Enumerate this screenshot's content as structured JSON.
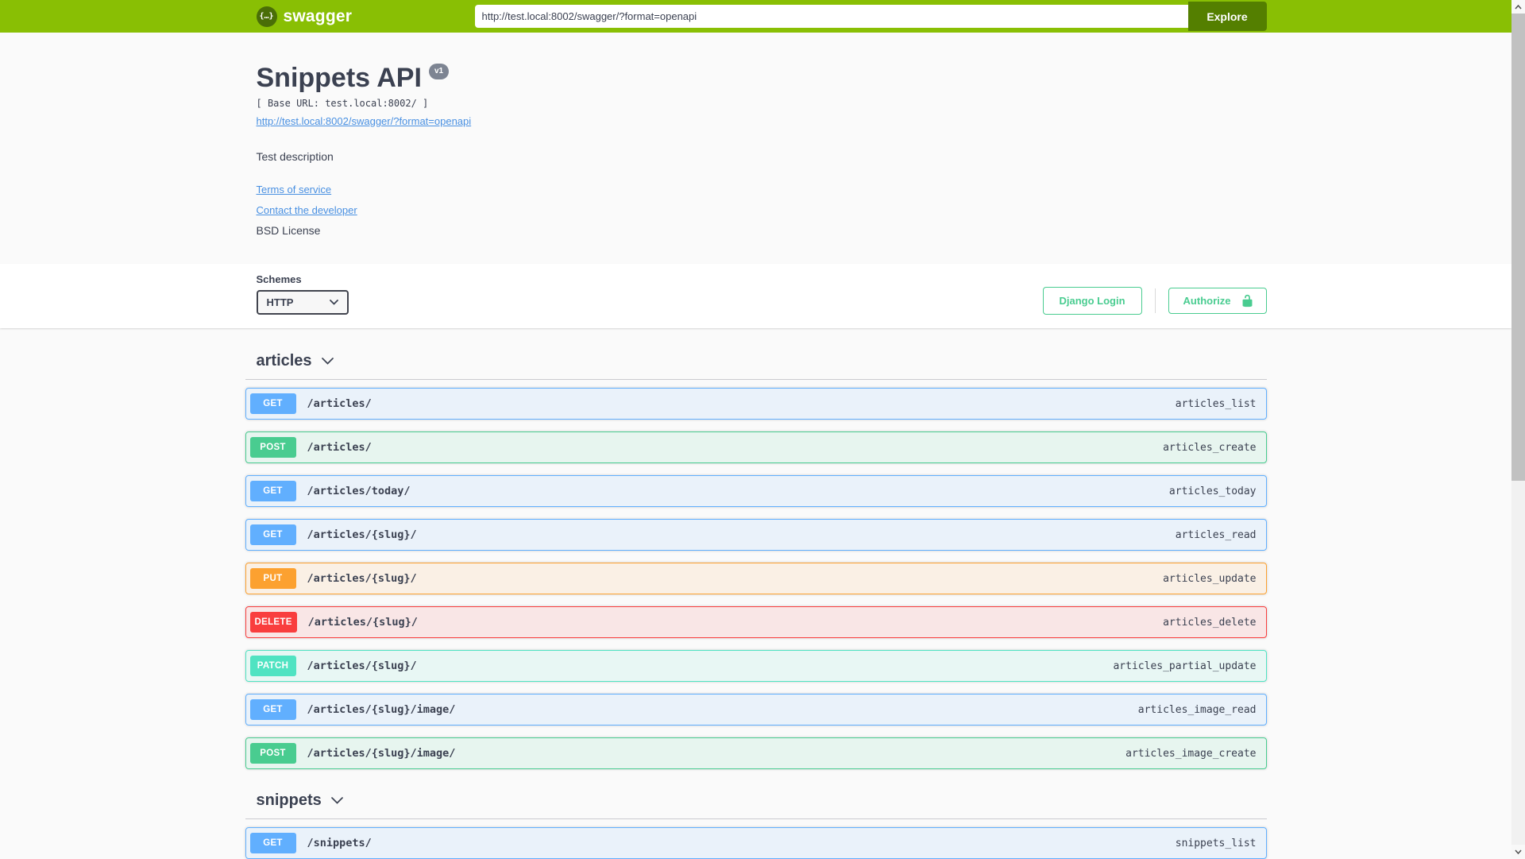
{
  "topbar": {
    "logo_text": "swagger",
    "url_value": "http://test.local:8002/swagger/?format=openapi",
    "explore_label": "Explore"
  },
  "info": {
    "title": "Snippets API",
    "version_badge": "v1",
    "base_url": "[ Base URL: test.local:8002/ ]",
    "spec_link": "http://test.local:8002/swagger/?format=openapi",
    "description": "Test description",
    "terms_of_service": "Terms of service",
    "contact": "Contact the developer",
    "license": "BSD License"
  },
  "schemes": {
    "label": "Schemes",
    "selected": "HTTP"
  },
  "auth": {
    "django_login_label": "Django Login",
    "authorize_label": "Authorize"
  },
  "icons": {
    "logo_glyph": "{…}",
    "select_chevron": "chevron-down",
    "section_chevron": "chevron-down",
    "authorize_lock": "unlocked-padlock",
    "scrollbar_up": "chevron-up",
    "scrollbar_down": "chevron-down"
  },
  "colors": {
    "topbar_green": "#89bf04",
    "explore_button_green": "#547f00",
    "accent_green": "#49cc90",
    "link_blue": "#4990e2",
    "text_dark": "#3b4151",
    "version_badge_gray": "#7d8492",
    "methods": {
      "GET": "#61affe",
      "POST": "#49cc90",
      "PUT": "#fca130",
      "DELETE": "#f93e3e",
      "PATCH": "#50e3c2"
    }
  },
  "sections": [
    {
      "tag": "articles",
      "operations": [
        {
          "method": "GET",
          "path": "/articles/",
          "op_id": "articles_list"
        },
        {
          "method": "POST",
          "path": "/articles/",
          "op_id": "articles_create"
        },
        {
          "method": "GET",
          "path": "/articles/today/",
          "op_id": "articles_today"
        },
        {
          "method": "GET",
          "path": "/articles/{slug}/",
          "op_id": "articles_read"
        },
        {
          "method": "PUT",
          "path": "/articles/{slug}/",
          "op_id": "articles_update"
        },
        {
          "method": "DELETE",
          "path": "/articles/{slug}/",
          "op_id": "articles_delete"
        },
        {
          "method": "PATCH",
          "path": "/articles/{slug}/",
          "op_id": "articles_partial_update"
        },
        {
          "method": "GET",
          "path": "/articles/{slug}/image/",
          "op_id": "articles_image_read"
        },
        {
          "method": "POST",
          "path": "/articles/{slug}/image/",
          "op_id": "articles_image_create"
        }
      ]
    },
    {
      "tag": "snippets",
      "operations": [
        {
          "method": "GET",
          "path": "/snippets/",
          "op_id": "snippets_list"
        }
      ]
    }
  ]
}
